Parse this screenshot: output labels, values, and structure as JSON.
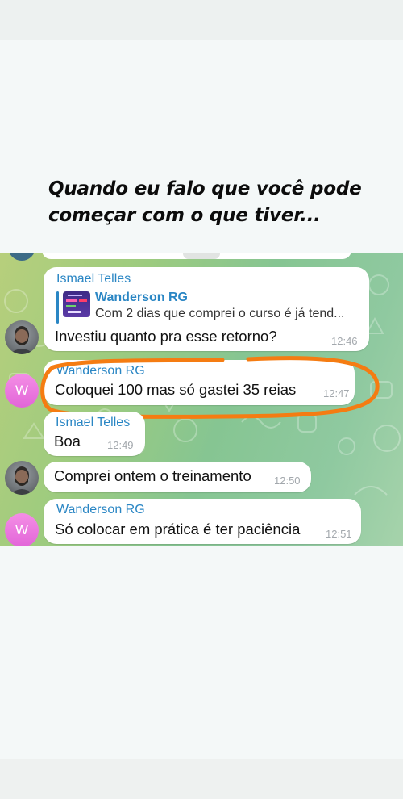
{
  "caption": {
    "line1": "Quando eu falo que você pode",
    "line2": "começar com o que tiver..."
  },
  "messages": [
    {
      "sender": "Ismael Telles",
      "reply": {
        "name": "Wanderson RG",
        "text": "Com 2 dias que comprei o curso é já tend..."
      },
      "text": "Investiu quanto pra esse retorno?",
      "time": "12:46"
    },
    {
      "sender": "Wanderson RG",
      "avatar_letter": "W",
      "text": "Coloquei 100 mas só gastei  35 reias",
      "time": "12:47",
      "highlighted": true
    },
    {
      "sender": "Ismael Telles",
      "text": "Boa",
      "time": "12:49"
    },
    {
      "text": "Comprei ontem o treinamento",
      "time": "12:50"
    },
    {
      "sender": "Wanderson RG",
      "avatar_letter": "W",
      "text": "Só colocar em prática é ter paciência",
      "time": "12:51"
    }
  ],
  "colors": {
    "sender_name": "#2a86c4",
    "highlight_ring": "#f57c12",
    "avatar_w": "#e46fda",
    "chat_background": "#9ccb7f"
  }
}
